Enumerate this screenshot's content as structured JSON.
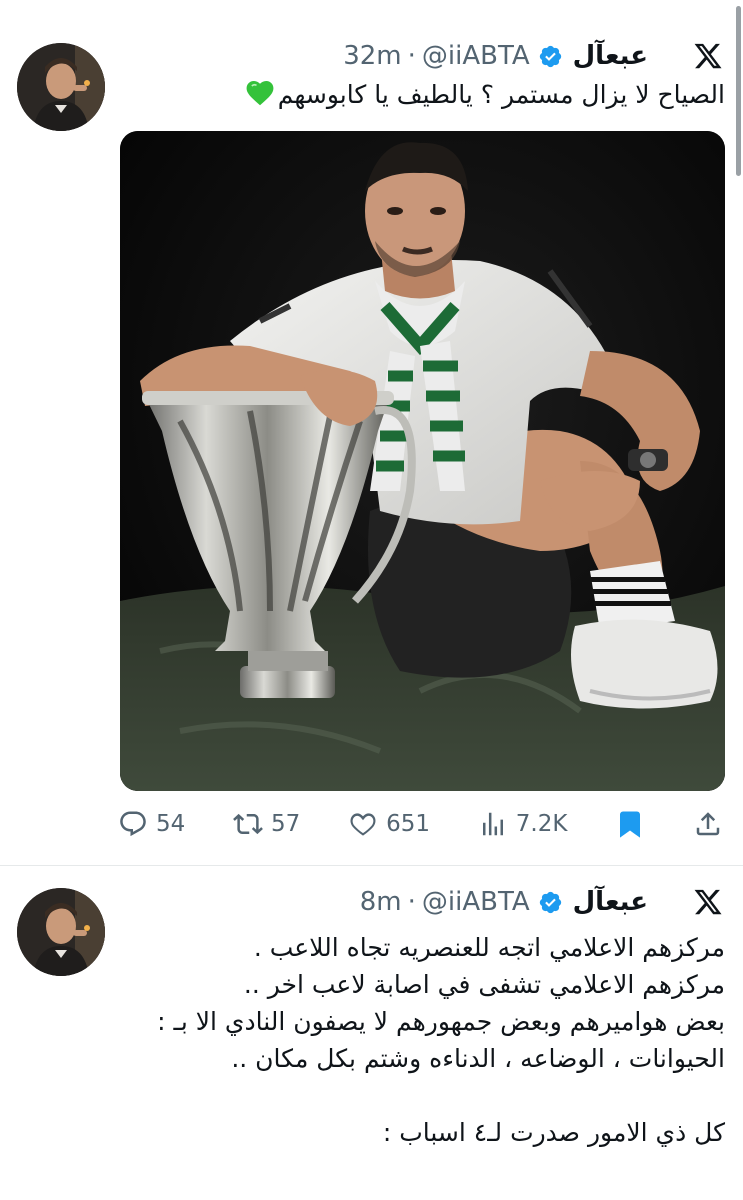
{
  "tweets": [
    {
      "author_name": "عبعآل",
      "handle": "@iiABTA",
      "separator": "·",
      "time": "32m",
      "text": "الصياح لا يزال مستمر ؟ يالطيف يا كابوسهم",
      "emoji": "green-heart",
      "media_icon": "trophy-photo",
      "actions": {
        "replies": "54",
        "reposts": "57",
        "likes": "651",
        "views": "7.2K"
      },
      "bookmarked": true
    },
    {
      "author_name": "عبعآل",
      "handle": "@iiABTA",
      "separator": "·",
      "time": "8m",
      "text": "مركزهم الاعلامي اتجه للعنصريه تجاه اللاعب .\nمركزهم الاعلامي تشفى في اصابة لاعب اخر ..\nبعض هواميرهم وبعض جمهورهم لا يصفون النادي الا بـ :\nالحيوانات ، الوضاعه ، الدناءه وشتم بكل مكان ..\n\nكل ذي الامور صدرت لـ٤ اسباب :"
    }
  ],
  "colors": {
    "text": "#0f1419",
    "meta": "#536471",
    "verified": "#1d9bf0",
    "bookmark": "#1d9bf0",
    "heart_emoji": "#34c23a"
  }
}
